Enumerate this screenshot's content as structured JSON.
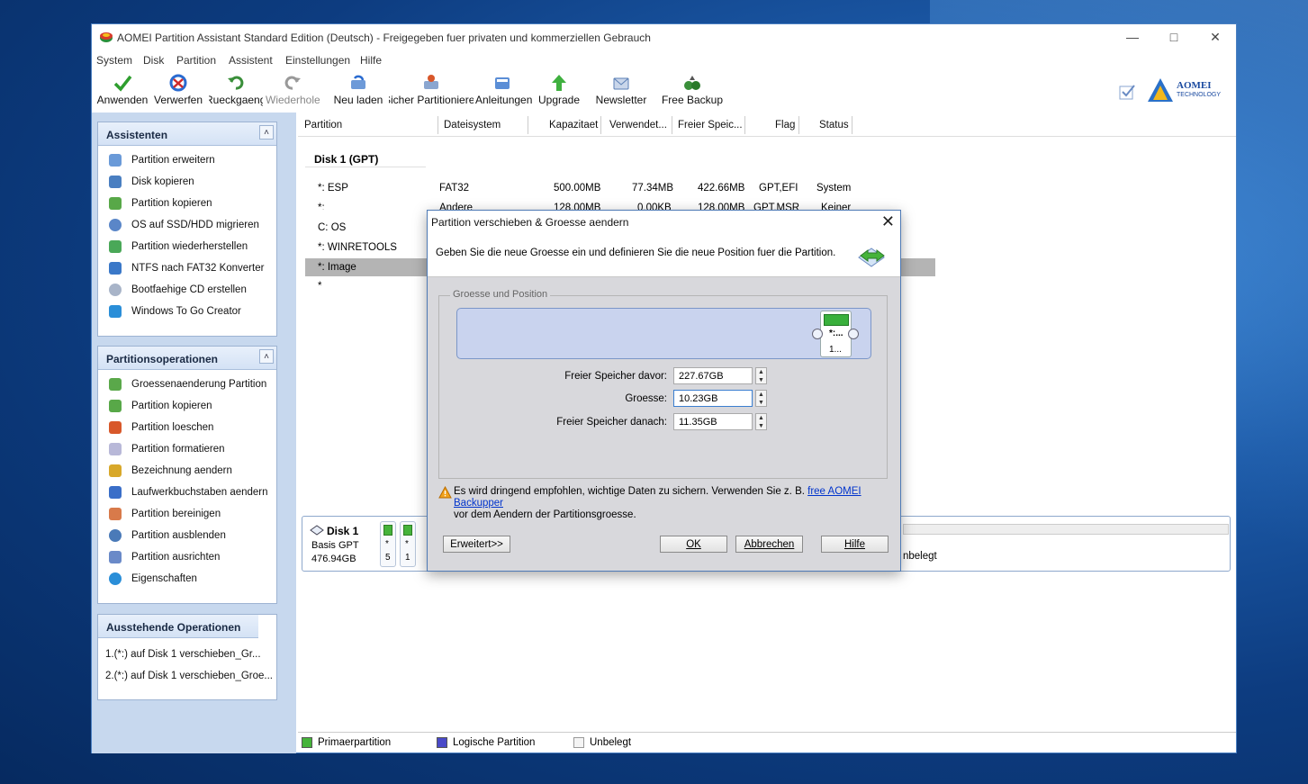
{
  "window": {
    "title": "AOMEI Partition Assistant Standard Edition (Deutsch) - Freigegeben fuer privaten und kommerziellen Gebrauch"
  },
  "menu": [
    "System",
    "Disk",
    "Partition",
    "Assistent",
    "Einstellungen",
    "Hilfe"
  ],
  "toolbar": {
    "apply": "Anwenden",
    "discard": "Verwerfen",
    "undo": "Rueckgaengig",
    "redo": "Wiederholen",
    "reload": "Neu laden",
    "safe_partition": "Sicher Partitionierer",
    "tutorials": "Anleitungen",
    "upgrade": "Upgrade",
    "newsletter": "Newsletter",
    "free_backup": "Free Backup"
  },
  "logo": {
    "name": "AOMEI",
    "sub": "TECHNOLOGY"
  },
  "assistants": {
    "title": "Assistenten",
    "items": [
      "Partition erweitern",
      "Disk kopieren",
      "Partition kopieren",
      "OS auf SSD/HDD migrieren",
      "Partition wiederherstellen",
      "NTFS nach FAT32 Konverter",
      "Bootfaehige CD erstellen",
      "Windows To Go Creator"
    ]
  },
  "partops": {
    "title": "Partitionsoperationen",
    "items": [
      "Groessenaenderung Partition",
      "Partition kopieren",
      "Partition loeschen",
      "Partition formatieren",
      "Bezeichnung aendern",
      "Laufwerkbuchstaben aendern",
      "Partition bereinigen",
      "Partition ausblenden",
      "Partition ausrichten",
      "Eigenschaften"
    ]
  },
  "pending": {
    "title": "Ausstehende Operationen",
    "items": [
      "1.(*:) auf Disk 1 verschieben_Gr...",
      "2.(*:) auf Disk 1 verschieben_Groe..."
    ]
  },
  "columns": [
    "Partition",
    "Dateisystem",
    "Kapazitaet",
    "Verwendet...",
    "Freier Speic...",
    "Flag",
    "Status"
  ],
  "disk_label": "Disk 1 (GPT)",
  "partitions": [
    {
      "name": "*: ESP",
      "fs": "FAT32",
      "cap": "500.00MB",
      "used": "77.34MB",
      "free": "422.66MB",
      "flag": "GPT,EFI",
      "status": "System"
    },
    {
      "name": "*:",
      "fs": "Andere",
      "cap": "128.00MB",
      "used": "0.00KB",
      "free": "128.00MB",
      "flag": "GPT,MSR",
      "status": "Keiner"
    },
    {
      "name": "C: OS",
      "fs": "",
      "cap": "",
      "used": "",
      "free": "",
      "flag": "",
      "status": ""
    },
    {
      "name": "*: WINRETOOLS",
      "fs": "",
      "cap": "",
      "used": "",
      "free": "",
      "flag": "",
      "status": ""
    },
    {
      "name": "*: Image",
      "fs": "",
      "cap": "",
      "used": "",
      "free": "",
      "flag": "",
      "status": ""
    },
    {
      "name": "*",
      "fs": "",
      "cap": "",
      "used": "",
      "free": "",
      "flag": "",
      "status": ""
    }
  ],
  "diskmap": {
    "name": "Disk 1",
    "type": "Basis GPT",
    "size": "476.94GB",
    "p1_t1": "*",
    "p1_t2": "5",
    "p2_t1": "*",
    "p2_t2": "1",
    "unalloc": "nbelegt"
  },
  "legend": {
    "primary": "Primaerpartition",
    "logical": "Logische Partition",
    "unalloc": "Unbelegt"
  },
  "dialog": {
    "title": "Partition verschieben & Groesse aendern",
    "info": "Geben Sie die neue Groesse ein und definieren Sie die neue Position fuer die Partition.",
    "group": "Groesse und Position",
    "block_l1": "*:...",
    "block_l2": "1...",
    "free_before_label": "Freier Speicher davor:",
    "free_before": "227.67GB",
    "size_label": "Groesse:",
    "size": "10.23GB",
    "free_after_label": "Freier Speicher danach:",
    "free_after": "11.35GB",
    "warning_pre": "Es wird dringend empfohlen, wichtige Daten zu sichern. Verwenden Sie z. B.",
    "warning_link": "free AOMEI Backupper",
    "warning_post": "vor dem Aendern der Partitionsgroesse.",
    "advanced": "Erweitert>>",
    "ok": "OK",
    "cancel": "Abbrechen",
    "help": "Hilfe"
  },
  "colors": {
    "primary": "#45b33a",
    "logical": "#4a4ac8",
    "selection": "#b4b4b4",
    "accent": "#1c5aa8"
  }
}
